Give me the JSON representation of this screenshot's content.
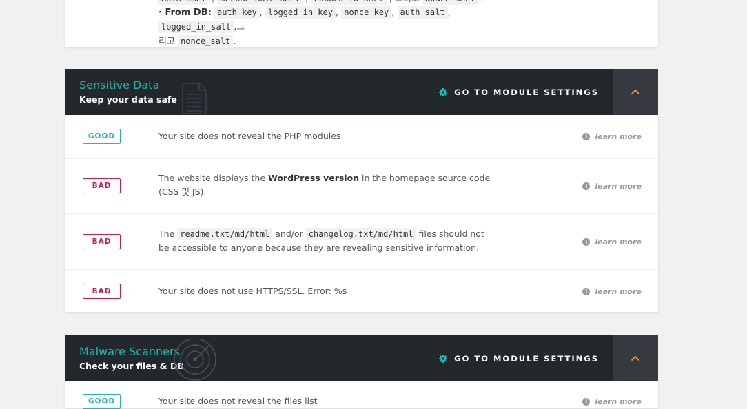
{
  "previous_module": {
    "line0": "AUTH_SALT , SECURE_AUTH_SALT , LOGGED_IN_SALT , 그리고 NONCE_SALT .",
    "from_db_label": "· From DB:",
    "keys": [
      "auth_key",
      "logged_in_key",
      "nonce_key",
      "auth_salt",
      "logged_in_salt"
    ],
    "and_text": "그",
    "and_text2": "리고",
    "last_key": "nonce_salt",
    "period": "."
  },
  "modules": [
    {
      "title": "Sensitive Data",
      "subtitle": "Keep your data safe",
      "settings_label": "GO TO MODULE SETTINGS",
      "icon": "document-icon",
      "rows": [
        {
          "status": "GOOD",
          "text": "Your site does not reveal the PHP modules.",
          "link": "learn more"
        },
        {
          "status": "BAD",
          "text_before": "The website displays the ",
          "text_bold": "WordPress version",
          "text_after": " in the homepage source code (CSS 및 JS).",
          "link": "learn more"
        },
        {
          "status": "BAD",
          "t1": "The ",
          "c1": "readme.txt/md/html",
          "t2": " and/or ",
          "c2": "changelog.txt/md/html",
          "t3": " files should not be accessible to anyone because they are revealing sensitive information.",
          "link": "learn more"
        },
        {
          "status": "BAD",
          "text": "Your site does not use HTTPS/SSL. Error: %s",
          "link": "learn more"
        }
      ]
    },
    {
      "title": "Malware Scanners",
      "subtitle": "Check your files & DB",
      "settings_label": "GO TO MODULE SETTINGS",
      "icon": "radar-icon",
      "rows": [
        {
          "status": "GOOD",
          "text": "Your site does not reveal the files list",
          "link": "learn more"
        }
      ]
    }
  ],
  "colors": {
    "accent": "#1ebbb0",
    "bad": "#c81d4b",
    "header_bg": "#23282d",
    "toggle_bg": "#343a40",
    "chevron": "#f0a020"
  }
}
